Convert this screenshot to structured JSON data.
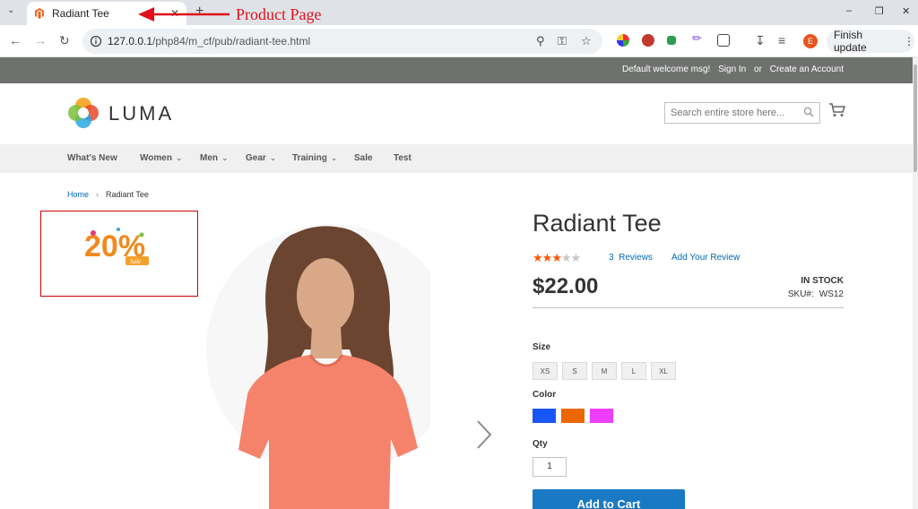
{
  "browser": {
    "tab_title": "Radiant Tee",
    "new_tab": "+",
    "url_host": "127.0.0.1",
    "url_path": "/php84/m_cf/pub/radiant-tee.html",
    "finish_update": "Finish update",
    "profile_initial": "E"
  },
  "annotation": {
    "text": "Product Page",
    "color": "#e0111b"
  },
  "header_panel": {
    "welcome": "Default welcome msg!",
    "sign_in": "Sign In",
    "or": "or",
    "create_account": "Create an Account"
  },
  "logo": {
    "text": "LUMA"
  },
  "search": {
    "placeholder": "Search entire store here..."
  },
  "nav": {
    "items": [
      {
        "label": "What's New",
        "has_menu": false
      },
      {
        "label": "Women",
        "has_menu": true
      },
      {
        "label": "Men",
        "has_menu": true
      },
      {
        "label": "Gear",
        "has_menu": true
      },
      {
        "label": "Training",
        "has_menu": true
      },
      {
        "label": "Sale",
        "has_menu": false
      },
      {
        "label": "Test",
        "has_menu": false
      }
    ]
  },
  "breadcrumb": {
    "home": "Home",
    "current": "Radiant Tee"
  },
  "sale_badge": {
    "text": "20%",
    "sub": "Sale"
  },
  "product": {
    "name": "Radiant Tee",
    "rating_stars": 3,
    "rating_max": 5,
    "reviews_count": "3",
    "reviews_label": "Reviews",
    "add_review": "Add Your Review",
    "price": "$22.00",
    "stock": "IN STOCK",
    "sku_label": "SKU#:",
    "sku": "WS12",
    "size_label": "Size",
    "sizes": [
      "XS",
      "S",
      "M",
      "L",
      "XL"
    ],
    "color_label": "Color",
    "colors": [
      "#1857f7",
      "#eb6703",
      "#ef3dff"
    ],
    "qty_label": "Qty",
    "qty": "1",
    "add_to_cart": "Add to Cart"
  },
  "colors": {
    "panel_header": "#6e716e",
    "nav_bg": "#f0f0f0",
    "link": "#006bb4",
    "star_on": "#ff5501",
    "primary_button": "#1979c3"
  }
}
